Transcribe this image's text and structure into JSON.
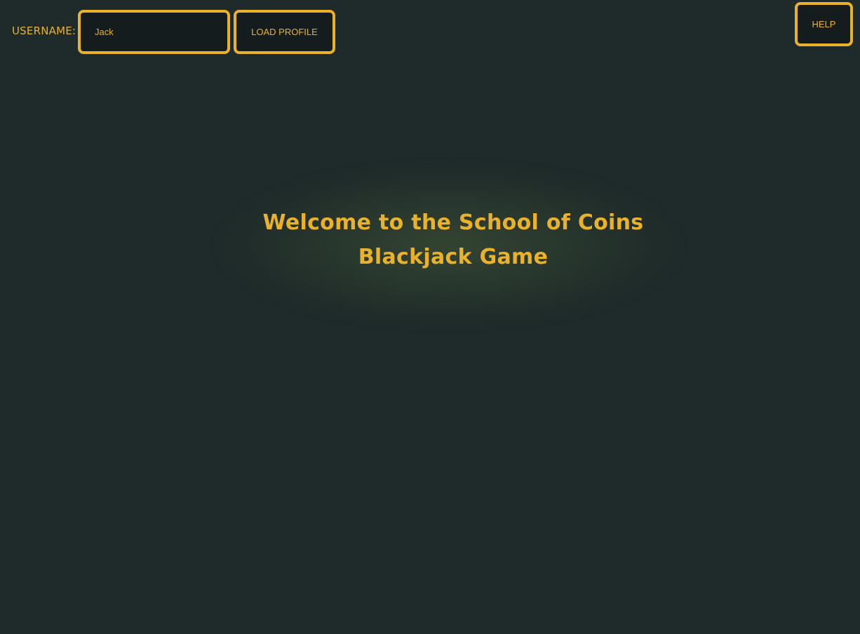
{
  "header": {
    "username_label": "USERNAME:",
    "username_value": "Jack",
    "load_profile_label": "LOAD PROFILE",
    "help_label": "HELP"
  },
  "main": {
    "welcome_line1": "Welcome to the School of Coins",
    "welcome_line2": "Blackjack Game"
  },
  "colors": {
    "background": "#1f2a2a",
    "accent": "#eab22b",
    "control_bg": "#141c1e"
  }
}
